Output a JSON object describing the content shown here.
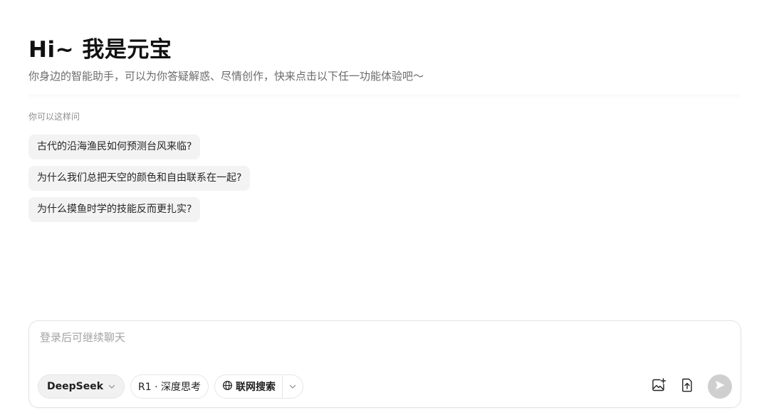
{
  "hero": {
    "title": "Hi~ 我是元宝",
    "subtitle": "你身边的智能助手，可以为你答疑解惑、尽情创作，快来点击以下任一功能体验吧～"
  },
  "suggestions": {
    "hint": "你可以这样问",
    "items": [
      "古代的沿海渔民如何预测台风来临?",
      "为什么我们总把天空的颜色和自由联系在一起?",
      "为什么摸鱼时学的技能反而更扎实?"
    ]
  },
  "composer": {
    "placeholder": "登录后可继续聊天",
    "model_label": "DeepSeek",
    "deep_think_label": "R1 · 深度思考",
    "web_search_label": "联网搜索",
    "icons": [
      "chevron-down-icon",
      "globe-icon",
      "image-add-icon",
      "file-upload-icon",
      "send-icon"
    ]
  },
  "colors": {
    "chip_bg": "#f3f3f3",
    "send_disabled": "#cfcfcf",
    "border": "#e3e3e3"
  }
}
